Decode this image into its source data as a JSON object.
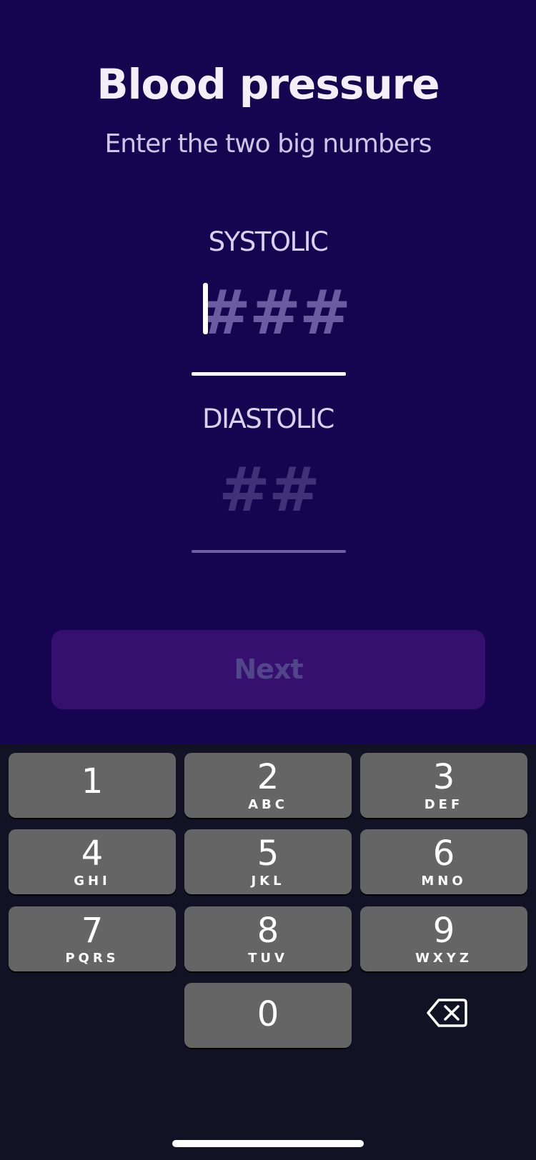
{
  "header": {
    "title": "Blood pressure",
    "subtitle": "Enter the two big numbers"
  },
  "form": {
    "systolic": {
      "label": "SYSTOLIC",
      "placeholder": "###",
      "value": "",
      "focused": true
    },
    "diastolic": {
      "label": "DIASTOLIC",
      "placeholder": "##",
      "value": "",
      "focused": false
    },
    "next_label": "Next",
    "next_enabled": false
  },
  "keypad": {
    "keys": [
      {
        "digit": "1",
        "letters": ""
      },
      {
        "digit": "2",
        "letters": "ABC"
      },
      {
        "digit": "3",
        "letters": "DEF"
      },
      {
        "digit": "4",
        "letters": "GHI"
      },
      {
        "digit": "5",
        "letters": "JKL"
      },
      {
        "digit": "6",
        "letters": "MNO"
      },
      {
        "digit": "7",
        "letters": "PQRS"
      },
      {
        "digit": "8",
        "letters": "TUV"
      },
      {
        "digit": "9",
        "letters": "WXYZ"
      },
      {
        "digit": "0",
        "letters": ""
      }
    ],
    "backspace_icon": "backspace-icon"
  },
  "colors": {
    "background": "#150551",
    "button": "#36106f",
    "keyboard": "#131225",
    "key": "#656565"
  }
}
